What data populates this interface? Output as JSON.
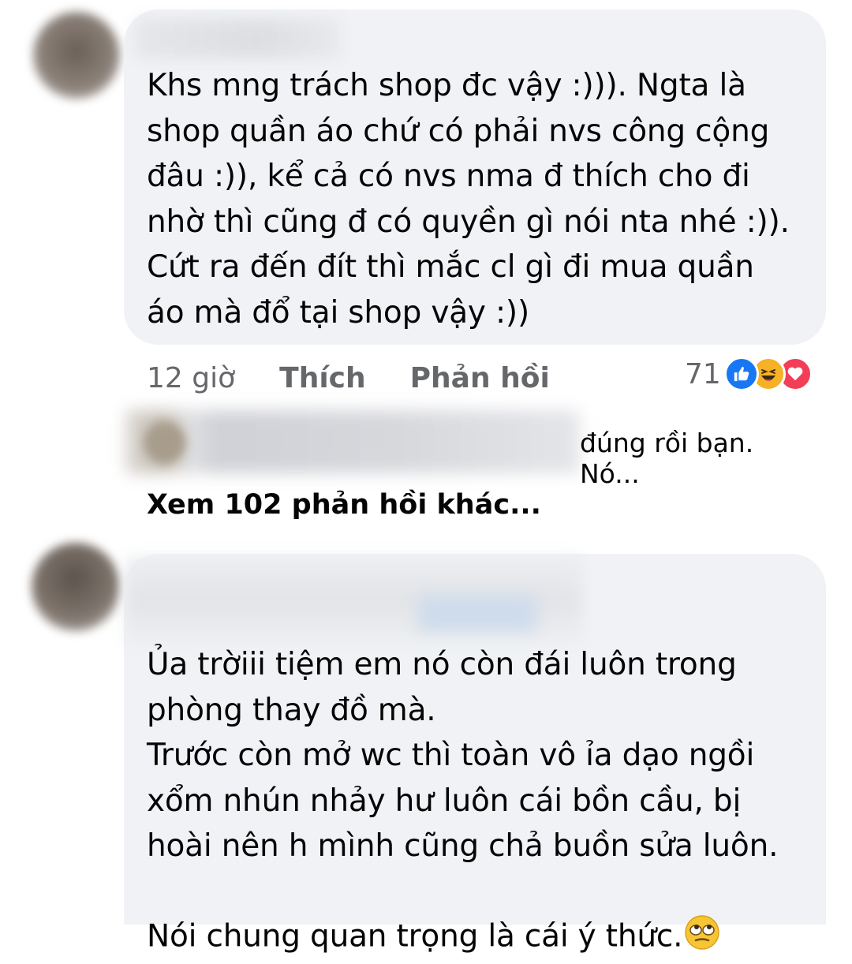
{
  "comments": [
    {
      "text": "Khs mng trách shop đc vậy :))). Ngta là\nshop quần áo chứ có phải nvs công cộng\nđâu :)), kể cả có nvs nma đ thích cho đi\nnhờ thì cũng đ có quyền gì nói nta nhé :)).\nCứt ra đến đít thì mắc cl gì đi mua quần\náo mà đổ tại shop vậy :))",
      "time": "12 giờ",
      "like_label": "Thích",
      "reply_label": "Phản hồi",
      "reaction_count": "71",
      "reactions": [
        "like-icon",
        "haha-icon",
        "love-icon"
      ]
    },
    {
      "text": "Ủa trờiii tiệm em nó còn đái luôn trong\nphòng thay đồ mà.\nTrước còn mở wc thì toàn vô ỉa dạo ngồi\nxổm nhún nhảy hư luôn cái bồn cầu, bị\nhoài nên h mình cũng chả buồn sửa luôn.\nNói chung quan trọng là cái ý thức.",
      "emoji": "rolling-eyes-emoji"
    }
  ],
  "reply_preview": {
    "snippet": "đúng rồi bạn. Nó..."
  },
  "more_replies_label": "Xem 102 phản hồi khác...",
  "colors": {
    "bubble": "#f0f2f5",
    "secondary_text": "#65676b",
    "like_blue": "#1877f2",
    "haha_yellow": "#f7b125",
    "love_red": "#f33e58"
  }
}
